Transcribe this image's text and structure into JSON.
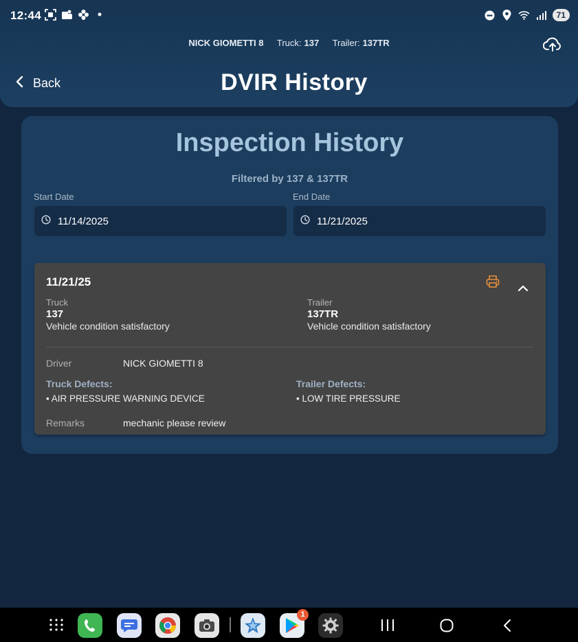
{
  "status": {
    "time": "12:44",
    "battery": "71"
  },
  "header": {
    "driver_name": "NICK GIOMETTI 8",
    "truck_label": "Truck:",
    "truck_value": "137",
    "trailer_label": "Trailer:",
    "trailer_value": "137TR",
    "back_label": "Back",
    "title": "DVIR History"
  },
  "panel": {
    "title": "Inspection History",
    "filter_text": "Filtered by 137 & 137TR",
    "start_date_label": "Start Date",
    "start_date_value": "11/14/2025",
    "end_date_label": "End Date",
    "end_date_value": "11/21/2025"
  },
  "card": {
    "date": "11/21/25",
    "truck_label": "Truck",
    "truck_value": "137",
    "truck_status": "Vehicle condition satisfactory",
    "trailer_label": "Trailer",
    "trailer_value": "137TR",
    "trailer_status": "Vehicle condition satisfactory",
    "driver_label": "Driver",
    "driver_value": "NICK GIOMETTI 8",
    "truck_defects_label": "Truck Defects:",
    "truck_defects": [
      "• AIR PRESSURE WARNING DEVICE"
    ],
    "trailer_defects_label": "Trailer Defects:",
    "trailer_defects": [
      "• LOW TIRE PRESSURE"
    ],
    "remarks_label": "Remarks",
    "remarks_value": "mechanic please review"
  },
  "navbar": {
    "play_badge": "1"
  },
  "colors": {
    "header_bg": "#1d3f61",
    "page_bg": "#122640",
    "panel_bg": "#1c3d5e",
    "card_bg": "#444444",
    "print_icon": "#e8903a",
    "panel_title": "#a6c4dd"
  }
}
